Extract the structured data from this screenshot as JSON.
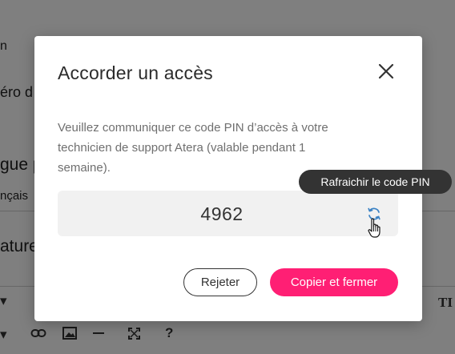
{
  "background": {
    "fragments": [
      "n",
      "éro d",
      "gue p",
      "nçais",
      "ature"
    ],
    "toolbar_right_label": "TI",
    "toolbar_icons": [
      "link-icon",
      "image-icon",
      "horizontal-rule-icon",
      "fullscreen-icon",
      "help-icon"
    ],
    "help_symbol": "?"
  },
  "modal": {
    "title": "Accorder un accès",
    "description": "Veuillez communiquer ce code PIN d’accès à votre technicien de support Atera (valable pendant 1 semaine).",
    "pin": "4962",
    "refresh_tooltip": "Rafraichir le code PIN",
    "reject_label": "Rejeter",
    "copy_close_label": "Copier et fermer"
  },
  "colors": {
    "accent": "#ff1f74",
    "overlay": "rgba(0,0,0,0.5)",
    "tooltip_bg": "#333333",
    "refresh_icon": "#3b82c4"
  }
}
